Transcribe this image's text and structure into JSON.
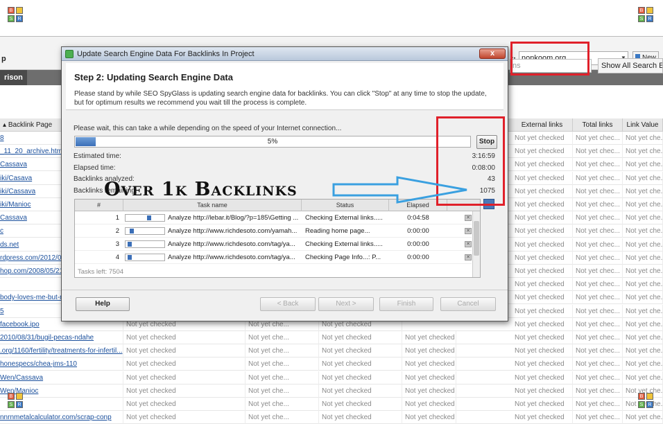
{
  "logos": {
    "q1": "B",
    "q2": "",
    "q3": "S",
    "q4": "R"
  },
  "app": {
    "left_label": "p",
    "tab_label": "rison",
    "project_label": "t:",
    "project_value": "nonkoom.org",
    "new_button": "New",
    "search_placeholder": "ns",
    "show_all_button": "Show All Search Eng",
    "columns": [
      "Backlink Page",
      "External links",
      "Total links",
      "Link Value"
    ]
  },
  "rows": [
    {
      "page": "8",
      "c1": "",
      "c2": "",
      "c3": "",
      "ext": "Not yet checked",
      "total": "Not yet chec...",
      "value": "Not yet che..."
    },
    {
      "page": "_11_20_archive.html",
      "c1": "",
      "c2": "",
      "c3": "",
      "ext": "Not yet checked",
      "total": "Not yet chec...",
      "value": "Not yet che..."
    },
    {
      "page": "Cassava",
      "c1": "",
      "c2": "",
      "c3": "",
      "ext": "Not yet checked",
      "total": "Not yet chec...",
      "value": "Not yet che..."
    },
    {
      "page": "iki/Casava",
      "c1": "",
      "c2": "",
      "c3": "",
      "ext": "Not yet checked",
      "total": "Not yet chec...",
      "value": "Not yet che..."
    },
    {
      "page": "iki/Cassava",
      "c1": "",
      "c2": "",
      "c3": "",
      "ext": "Not yet checked",
      "total": "Not yet chec...",
      "value": "Not yet che..."
    },
    {
      "page": "iki/Manioc",
      "c1": "",
      "c2": "",
      "c3": "",
      "ext": "Not yet checked",
      "total": "Not yet chec...",
      "value": "Not yet che..."
    },
    {
      "page": "Cassava",
      "c1": "",
      "c2": "",
      "c3": "",
      "ext": "Not yet checked",
      "total": "Not yet chec...",
      "value": "Not yet che..."
    },
    {
      "page": "c",
      "c1": "",
      "c2": "",
      "c3": "",
      "ext": "Not yet checked",
      "total": "Not yet chec...",
      "value": "Not yet che..."
    },
    {
      "page": "ds.net",
      "c1": "",
      "c2": "",
      "c3": "",
      "ext": "Not yet checked",
      "total": "Not yet chec...",
      "value": "Not yet che..."
    },
    {
      "page": "rdpress.com/2012/0",
      "c1": "",
      "c2": "",
      "c3": "",
      "ext": "Not yet checked",
      "total": "Not yet chec...",
      "value": "Not yet che..."
    },
    {
      "page": "hop.com/2008/05/21",
      "c1": "",
      "c2": "",
      "c3": "",
      "ext": "Not yet checked",
      "total": "Not yet chec...",
      "value": "Not yet che..."
    },
    {
      "page": "",
      "c1": "",
      "c2": "",
      "c3": "",
      "ext": "Not yet checked",
      "total": "Not yet chec...",
      "value": "Not yet che..."
    },
    {
      "page": "body-loves-me-but-n",
      "c1": "",
      "c2": "",
      "c3": "",
      "ext": "Not yet checked",
      "total": "Not yet chec...",
      "value": "Not yet che..."
    },
    {
      "page": "5",
      "c1": "",
      "c2": "",
      "c3": "",
      "ext": "Not yet checked",
      "total": "Not yet chec...",
      "value": "Not yet che..."
    },
    {
      "page": "facebook.ipo",
      "c1": "Not yet checked",
      "c2": "Not yet che...",
      "c3": "Not yet checked",
      "ext": "Not yet checked",
      "total": "Not yet chec...",
      "value": "Not yet che..."
    },
    {
      "page": "2010/08/31/bugil-pecas-ndahe",
      "c1": "Not yet checked",
      "c2": "Not yet che...",
      "c3": "Not yet checked",
      "c4": "Not yet checked",
      "ext": "Not yet checked",
      "total": "Not yet chec...",
      "value": "Not yet che..."
    },
    {
      "page": ".org/1160/fertility/treatments-for-infertil...",
      "c1": "Not yet checked",
      "c2": "Not yet che...",
      "c3": "Not yet checked",
      "c4": "Not yet checked",
      "ext": "Not yet checked",
      "total": "Not yet chec...",
      "value": "Not yet che..."
    },
    {
      "page": "honespecs/chea-jms-110",
      "c1": "Not yet checked",
      "c2": "Not yet che...",
      "c3": "Not yet checked",
      "c4": "Not yet checked",
      "ext": "Not yet checked",
      "total": "Not yet chec...",
      "value": "Not yet che..."
    },
    {
      "page": "Wen/Cassava",
      "c1": "Not yet checked",
      "c2": "Not yet che...",
      "c3": "Not yet checked",
      "c4": "Not yet checked",
      "ext": "Not yet checked",
      "total": "Not yet chec...",
      "value": "Not yet che..."
    },
    {
      "page": "Wen/Manioc",
      "c1": "Not yet checked",
      "c2": "Not yet che...",
      "c3": "Not yet checked",
      "c4": "Not yet checked",
      "ext": "Not yet checked",
      "total": "Not yet chec...",
      "value": "Not yet che..."
    },
    {
      "page": "",
      "c1": "Not yet checked",
      "c2": "Not yet che...",
      "c3": "Not yet checked",
      "c4": "Not yet checked",
      "ext": "Not yet checked",
      "total": "Not yet chec...",
      "value": "Not yet che..."
    },
    {
      "page": "nnrnmetalcalculator.com/scrap-conp",
      "c1": "Not yet checked",
      "c2": "Not yet che...",
      "c3": "Not yet checked",
      "c4": "Not yet checked",
      "ext": "Not yet checked",
      "total": "Not yet chec...",
      "value": "Not yet che..."
    }
  ],
  "dialog": {
    "title": "Update Search Engine Data For Backlinks In Project",
    "close": "x",
    "step_title": "Step 2: Updating Search Engine Data",
    "step_desc": "Please stand by while SEO SpyGlass is updating search engine data for backlinks. You can click \"Stop\" at any time to stop the update, but for optimum results we recommend you wait till the process is complete.",
    "wait_text": "Please wait, this can take a while depending on the speed of your Internet connection...",
    "progress_pct": 5,
    "progress_text": "5%",
    "stop": "Stop",
    "stats": [
      {
        "label": "Estimated time:",
        "value": "3:16:59"
      },
      {
        "label": "Elapsed time:",
        "value": "0:08:00"
      },
      {
        "label": "Backlinks analyzed:",
        "value": "43"
      },
      {
        "label": "Backlinks remaining:",
        "value": "1075"
      }
    ],
    "task_headers": [
      "#",
      "Task name",
      "Status",
      "Elapsed"
    ],
    "tasks": [
      {
        "num": "1",
        "name": "Analyze http://lebar.it/Blog/?p=185\\Getting ...",
        "status": "Checking External links.....",
        "elapsed": "0:04:58",
        "progress": 0.62
      },
      {
        "num": "2",
        "name": "Analyze http://www.richdesoto.com/yamah...",
        "status": "Reading home page...",
        "elapsed": "0:00:00",
        "progress": 0.1
      },
      {
        "num": "3",
        "name": "Analyze http://www.richdesoto.com/tag/ya...",
        "status": "Checking External links.....",
        "elapsed": "0:00:00",
        "progress": 0.05
      },
      {
        "num": "4",
        "name": "Analyze http://www.richdesoto.com/tag/ya...",
        "status": "Checking Page Info...: P...",
        "elapsed": "0:00:00",
        "progress": 0.05
      }
    ],
    "tasks_left": "Tasks left: 7504",
    "buttons": {
      "help": "Help",
      "back": "< Back",
      "next": "Next >",
      "finish": "Finish",
      "cancel": "Cancel"
    }
  },
  "annotation": {
    "text": "Over 1k Backlinks",
    "red": "#e0202a",
    "arrow": "#3aa0e0"
  }
}
